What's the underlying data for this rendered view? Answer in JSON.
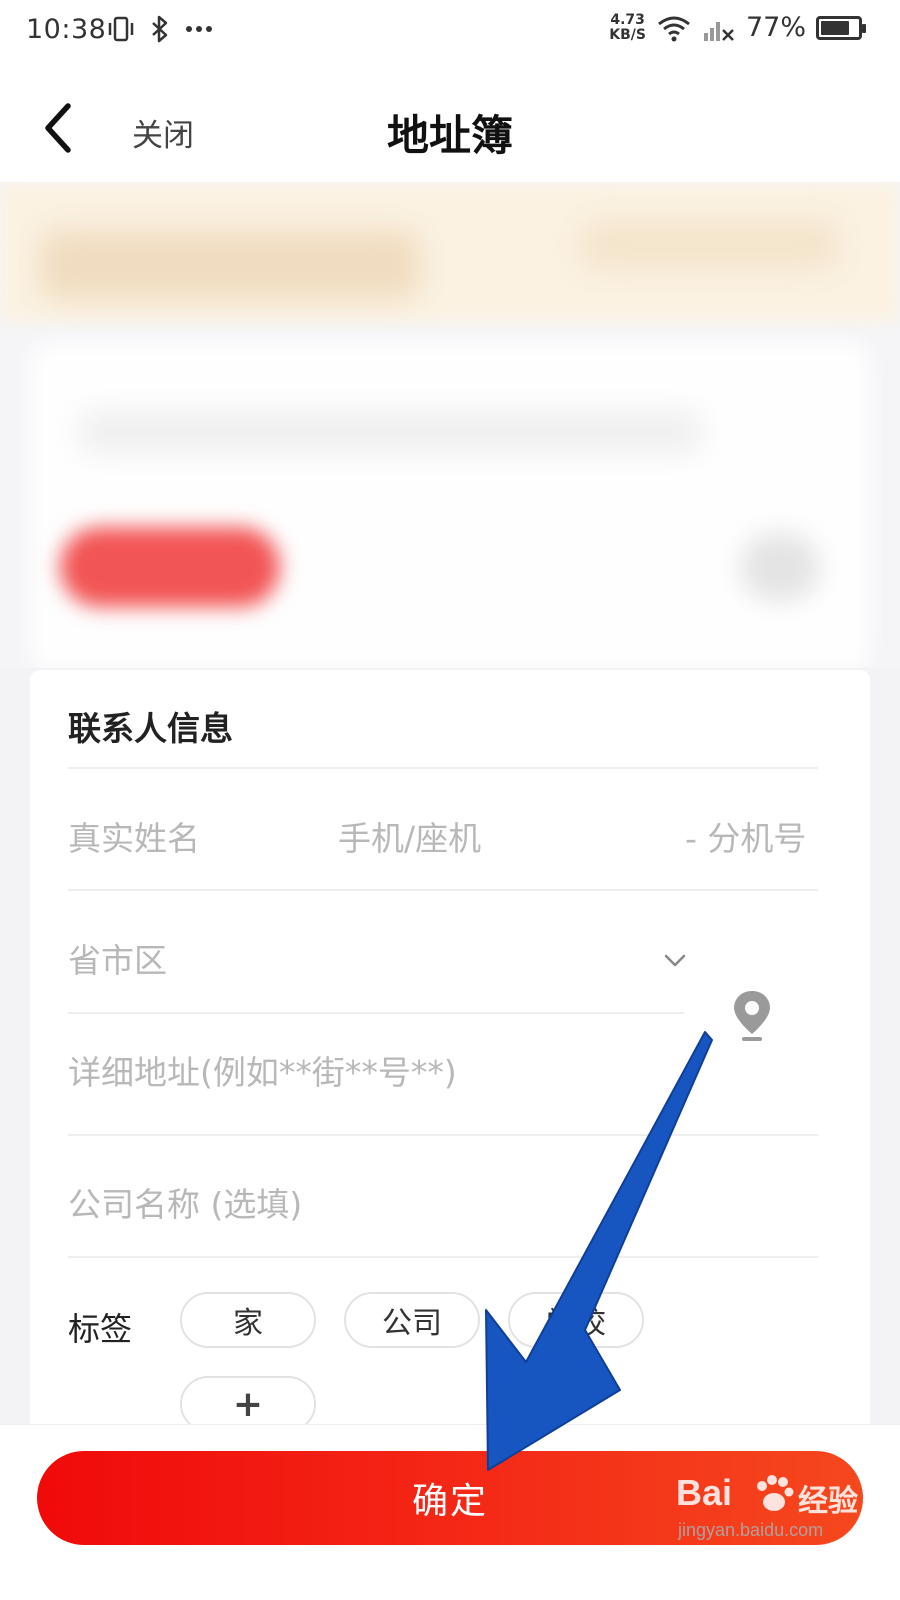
{
  "status_bar": {
    "time": "10:38",
    "network_speed_value": "4.73",
    "network_speed_unit": "KB/S",
    "battery_percent": "77%",
    "battery_level": 0.77,
    "icons": [
      "vibrate-icon",
      "bluetooth-icon",
      "more-dots-icon",
      "wifi-icon",
      "signal-no-sim-icon",
      "battery-icon"
    ]
  },
  "nav": {
    "back_icon": "chevron-left-icon",
    "close_label": "关闭",
    "title": "地址簿"
  },
  "contact_card": {
    "title": "联系人信息",
    "name_placeholder": "真实姓名",
    "phone_placeholder": "手机/座机",
    "extension_placeholder": "- 分机号",
    "region_placeholder": "省市区",
    "region_icon": "chevron-down-icon",
    "location_icon": "location-pin-icon",
    "address_placeholder": "详细地址(例如**街**号**)",
    "company_placeholder": "公司名称 (选填)",
    "tags_label": "标签",
    "tags": [
      "家",
      "公司",
      "学校"
    ],
    "add_tag_label": "+"
  },
  "bottom": {
    "confirm_label": "确定"
  },
  "watermark": {
    "brand": "Bai",
    "brand_suffix": "经验",
    "url": "jingyan.baidu.com"
  },
  "colors": {
    "primary_red": "#f00a0a",
    "primary_orange": "#f5481e",
    "annotation_arrow": "#1755c0",
    "placeholder_gray": "#b8b8b8"
  }
}
